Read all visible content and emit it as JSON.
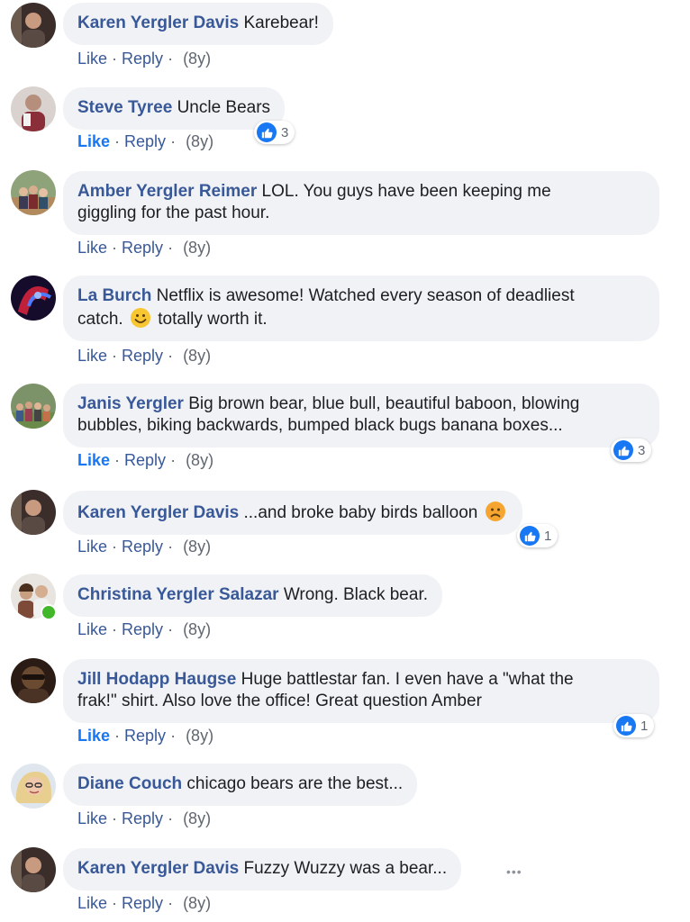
{
  "labels": {
    "like": "Like",
    "reply": "Reply",
    "sep": "·"
  },
  "colors": {
    "author": "#385898",
    "bubble": "#f0f2f5",
    "like_blue": "#1877f2",
    "online": "#42b72a"
  },
  "comments": [
    {
      "author": "Karen Yergler Davis",
      "text": "Karebear!",
      "time": "(8y)"
    },
    {
      "author": "Steve Tyree",
      "text": "Uncle Bears",
      "time": "(8y)",
      "reactions": "3",
      "liked": true
    },
    {
      "author": "Amber Yergler Reimer",
      "text_line1": "LOL. You guys have been keeping me",
      "text_line2": "giggling for the past hour.",
      "time": "(8y)"
    },
    {
      "author": "La Burch",
      "text_line1": "Netflix is awesome! Watched every season of deadliest",
      "text_line2a": "catch.",
      "emoji": "smiley-emoji",
      "text_line2b": "totally worth it.",
      "time": "(8y)"
    },
    {
      "author": "Janis Yergler",
      "text_line1": "Big brown bear, blue bull, beautiful baboon, blowing",
      "text_line2": "bubbles, biking backwards, bumped black bugs banana boxes...",
      "time": "(8y)",
      "reactions": "3",
      "liked": true
    },
    {
      "author": "Karen Yergler Davis",
      "text": "...and broke baby birds balloon",
      "emoji": "sad-emoji",
      "time": "(8y)",
      "reactions": "1"
    },
    {
      "author": "Christina Yergler Salazar",
      "text": "Wrong. Black bear.",
      "time": "(8y)"
    },
    {
      "author": "Jill Hodapp Haugse",
      "text_line1": "Huge battlestar fan. I even have a \"what the",
      "text_line2": "frak!\" shirt. Also love the office! Great question Amber",
      "time": "(8y)",
      "reactions": "1",
      "liked": true
    },
    {
      "author": "Diane Couch",
      "text": "chicago bears are the best...",
      "time": "(8y)"
    },
    {
      "author": "Karen Yergler Davis",
      "text": "Fuzzy Wuzzy was a bear...",
      "time": "(8y)",
      "more": "•••"
    }
  ]
}
